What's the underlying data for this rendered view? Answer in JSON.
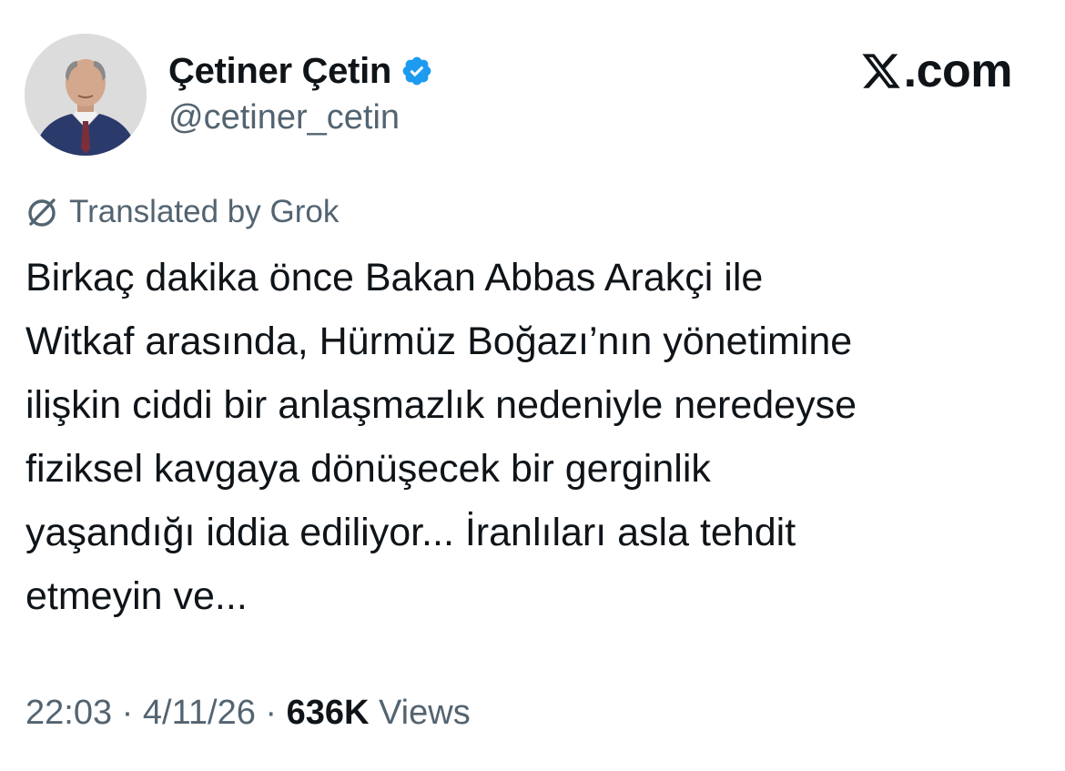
{
  "author": {
    "display_name": "Çetiner Çetin",
    "handle": "@cetiner_cetin",
    "verified": true,
    "avatar_icon": "profile-photo"
  },
  "brand": {
    "text": ".com",
    "logo_icon": "x-logo-icon"
  },
  "translation": {
    "label": "Translated by Grok",
    "icon": "grok-icon"
  },
  "tweet": {
    "lines": [
      "Birkaç dakika önce Bakan Abbas Arakçi ile",
      "Witkaf arasında, Hürmüz Boğazı’nın yönetimine",
      "ilişkin ciddi bir anlaşmazlık nedeniyle neredeyse",
      "fiziksel kavgaya dönüşecek bir gerginlik",
      "yaşandığı iddia ediliyor... İranlıları asla tehdit",
      "etmeyin ve..."
    ]
  },
  "meta": {
    "time": "22:03",
    "separator": " · ",
    "date": "4/11/26",
    "views_count": "636K",
    "views_label": " Views"
  },
  "colors": {
    "text_primary": "#0f1419",
    "text_secondary": "#536471",
    "verified_blue": "#1d9bf0",
    "background": "#ffffff"
  }
}
